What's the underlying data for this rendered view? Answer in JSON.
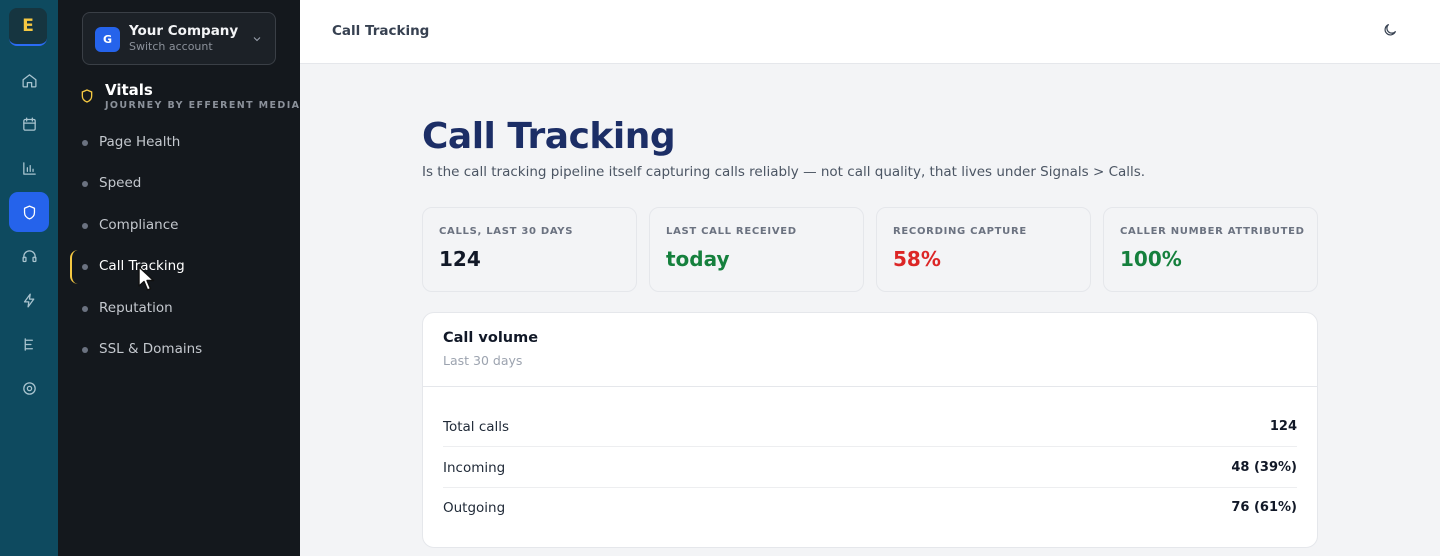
{
  "rail": {
    "logo_letter": "E",
    "items": [
      {
        "icon": "home-icon"
      },
      {
        "icon": "calendar-icon"
      },
      {
        "icon": "bar-chart-icon"
      },
      {
        "icon": "shield-icon",
        "active": true
      },
      {
        "icon": "headset-icon"
      },
      {
        "icon": "lightning-icon"
      },
      {
        "icon": "list-icon"
      },
      {
        "icon": "settings-icon"
      }
    ]
  },
  "account": {
    "avatar_letter": "G",
    "name": "Your Company",
    "sub": "Switch account"
  },
  "section": {
    "title": "Vitals",
    "subtitle": "JOURNEY BY EFFERENT MEDIA"
  },
  "nav": {
    "items": [
      {
        "label": "Page Health"
      },
      {
        "label": "Speed"
      },
      {
        "label": "Compliance"
      },
      {
        "label": "Call Tracking",
        "active": true
      },
      {
        "label": "Reputation"
      },
      {
        "label": "SSL & Domains"
      }
    ]
  },
  "topbar": {
    "breadcrumb": "Call Tracking",
    "theme_icon": "moon-icon"
  },
  "page": {
    "title": "Call Tracking",
    "description": "Is the call tracking pipeline itself capturing calls reliably — not call quality, that lives under Signals > Calls."
  },
  "kpis": [
    {
      "label": "CALLS, LAST 30 DAYS",
      "value": "124",
      "color": "#111827"
    },
    {
      "label": "LAST CALL RECEIVED",
      "value": "today",
      "color": "#15803d"
    },
    {
      "label": "RECORDING CAPTURE",
      "value": "58%",
      "color": "#dc2626"
    },
    {
      "label": "CALLER NUMBER ATTRIBUTED",
      "value": "100%",
      "color": "#15803d"
    }
  ],
  "volume": {
    "title": "Call volume",
    "subtitle": "Last 30 days",
    "rows": [
      {
        "label": "Total calls",
        "value": "124"
      },
      {
        "label": "Incoming",
        "value": "48 (39%)"
      },
      {
        "label": "Outgoing",
        "value": "76 (61%)"
      }
    ]
  },
  "colors": {
    "accent": "#2563eb",
    "rail_bg": "#0e4a5f",
    "sidenav_bg": "#14181d",
    "highlight": "#f5c842"
  }
}
